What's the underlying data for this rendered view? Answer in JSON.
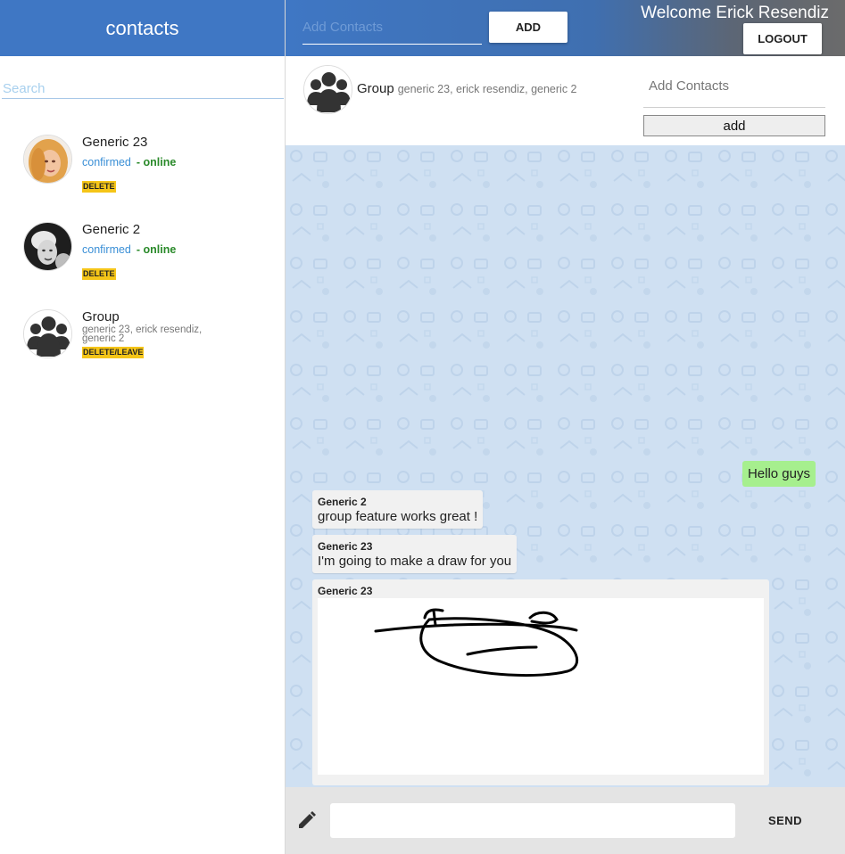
{
  "sidebar": {
    "title": "contacts",
    "search_placeholder": "Search",
    "contacts": [
      {
        "name": "Generic 23",
        "status": "confirmed",
        "presence": "- online",
        "action": "DELETE",
        "avatar": "woman-photo"
      },
      {
        "name": "Generic 2",
        "status": "confirmed",
        "presence": "- online",
        "action": "DELETE",
        "avatar": "bw-woman-photo"
      },
      {
        "name": "Group",
        "members": "generic 23, erick resendiz, generic 2",
        "action": "DELETE/LEAVE",
        "avatar": "group-icon"
      }
    ]
  },
  "topbar": {
    "add_contacts_placeholder": "Add Contacts",
    "add_label": "ADD",
    "welcome": "Welcome Erick Resendiz",
    "logout_label": "LOGOUT"
  },
  "chat_header": {
    "title": "Group",
    "members": "generic 23, erick resendiz, generic 2",
    "add_contacts_label": "Add Contacts",
    "add_button": "add"
  },
  "messages": [
    {
      "mine": true,
      "text": "Hello guys"
    },
    {
      "sender": "Generic 2",
      "text": "group feature works great !"
    },
    {
      "sender": "Generic 23",
      "text": "I'm going to make a draw for you"
    },
    {
      "sender": "Generic 23",
      "type": "drawing"
    }
  ],
  "composer": {
    "send_label": "SEND",
    "icon": "pencil-icon"
  },
  "colors": {
    "header_blue": "#3f77c4",
    "badge_yellow": "#f5c518",
    "mine_bubble": "#a6ef8e",
    "chat_bg": "#cfe0f2",
    "online_green": "#2a8a2a",
    "confirmed_blue": "#3a8fd6"
  }
}
